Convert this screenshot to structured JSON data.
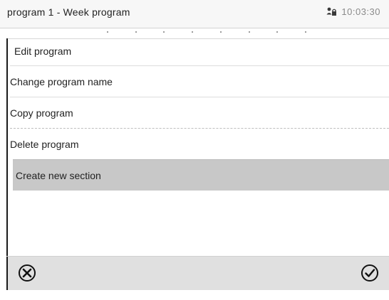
{
  "header": {
    "title": "program 1 - Week program",
    "time": "10:03:30",
    "lock_icon": "user-lock-icon"
  },
  "menu": {
    "title": "Edit program",
    "items": [
      {
        "label": "Change program name"
      },
      {
        "label": "Copy program"
      },
      {
        "label": "Delete program"
      },
      {
        "label": "Create new section"
      }
    ],
    "selected_index": 3
  },
  "footer": {
    "cancel_icon": "cancel-circle-x-icon",
    "confirm_icon": "confirm-circle-check-icon"
  },
  "colors": {
    "header_bg": "#f7f7f7",
    "selected_bg": "#c8c8c8",
    "footer_bg": "#e0e0e0",
    "rule": "#1a1a1a"
  }
}
